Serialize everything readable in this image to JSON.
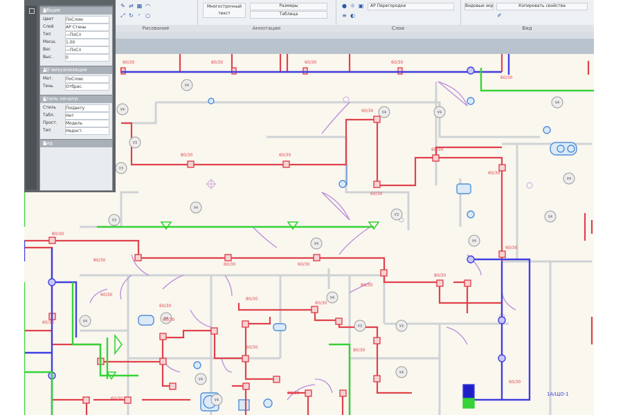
{
  "ribbon": {
    "groups": [
      {
        "id": "g1",
        "label": "Рисование"
      },
      {
        "id": "g2",
        "label": "Аннотации"
      },
      {
        "id": "g3",
        "label": "Слои"
      },
      {
        "id": "g4",
        "label": "Вид"
      }
    ],
    "buttons": {
      "text": "Многострочный текст",
      "dims": "Размеры",
      "table": "Таблица",
      "layer": "АР Перегородки",
      "view": "Видовые экраны",
      "match": "Копировать свойства"
    }
  },
  "properties_panel": {
    "sections": [
      {
        "title": "Общие",
        "rows": [
          [
            "Цвет",
            "ПоСлою"
          ],
          [
            "Слой",
            "АР Стены"
          ],
          [
            "Тип",
            "—ПоСл"
          ],
          [
            "Масш.",
            "1.00"
          ],
          [
            "Вес",
            "—ПоСл"
          ],
          [
            "Выс.",
            "0"
          ]
        ]
      },
      {
        "title": "3D визуализация",
        "rows": [
          [
            "Мат.",
            "ПоСлою"
          ],
          [
            "Тень",
            "Отбрас."
          ]
        ]
      },
      {
        "title": "Стиль печати",
        "rows": [
          [
            "Стиль",
            "ПоЦвету"
          ],
          [
            "Табл.",
            "Нет"
          ],
          [
            "Прост.",
            "Модель"
          ],
          [
            "Тип",
            "Недост."
          ]
        ]
      },
      {
        "title": "Вид",
        "rows": []
      }
    ]
  },
  "colors": {
    "red": "#e0414a",
    "blue": "#3f3fe0",
    "green": "#35d335",
    "wall": "#cfd3d5",
    "door": "#b98ad8",
    "fixture": "#c9a8e0",
    "paper": "#faf7ef"
  },
  "cad_labels": [
    {
      "id": "l1",
      "text": "60/30"
    },
    {
      "id": "l2",
      "text": "80/30"
    },
    {
      "id": "l3",
      "text": "60/30"
    },
    {
      "id": "l4",
      "text": "60/30"
    },
    {
      "id": "l5",
      "text": "60/30"
    },
    {
      "id": "l6",
      "text": "80/30"
    },
    {
      "id": "l7",
      "text": "60/30"
    },
    {
      "id": "l8",
      "text": "60/30"
    },
    {
      "id": "l9",
      "text": "60/30"
    },
    {
      "id": "l10",
      "text": "60/30"
    },
    {
      "id": "l11",
      "text": "60/30"
    },
    {
      "id": "l12",
      "text": "80/30"
    },
    {
      "id": "l13",
      "text": "80/30"
    },
    {
      "id": "l14",
      "text": "60/30"
    },
    {
      "id": "l15",
      "text": "60/30"
    },
    {
      "id": "l16",
      "text": "80/30"
    },
    {
      "id": "l17",
      "text": "60/30"
    },
    {
      "id": "l18",
      "text": "80/30"
    },
    {
      "id": "l19",
      "text": "60/30"
    },
    {
      "id": "l20",
      "text": "60/30"
    },
    {
      "id": "l21",
      "text": "80/30"
    },
    {
      "id": "l22",
      "text": "60/30"
    },
    {
      "id": "l23",
      "text": "60/30"
    },
    {
      "id": "l24",
      "text": "60/30"
    },
    {
      "id": "l25",
      "text": "60/30"
    },
    {
      "id": "l26",
      "text": "80/30"
    },
    {
      "id": "l27",
      "text": "60/30"
    },
    {
      "id": "l28",
      "text": "60/30"
    },
    {
      "id": "l29",
      "text": "60/30"
    }
  ],
  "tags": [
    "У4",
    "У4",
    "У4",
    "У4",
    "У4",
    "У3",
    "У4",
    "У3",
    "У3",
    "У4",
    "У4",
    "У4",
    "У4",
    "У3",
    "У3",
    "У4",
    "У4",
    "У4",
    "У3",
    "У4",
    "У4",
    "У4"
  ]
}
